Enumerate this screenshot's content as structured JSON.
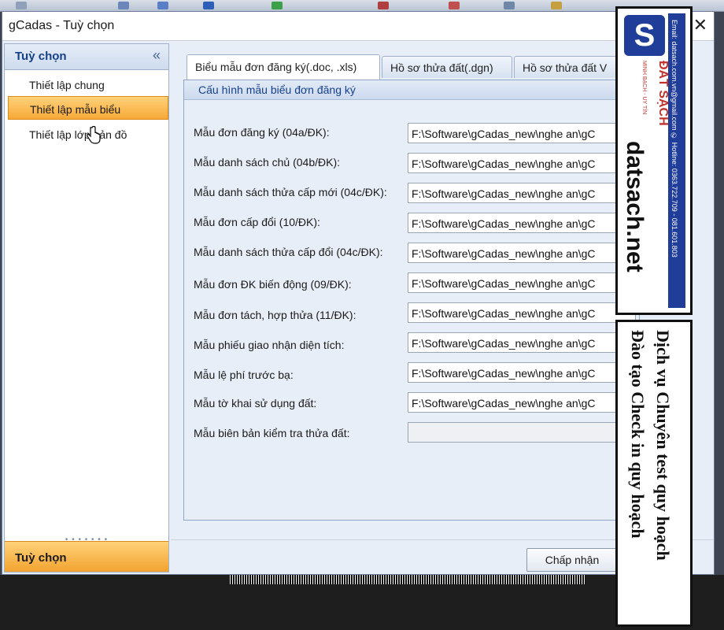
{
  "window": {
    "title": "gCadas - Tuỳ chọn",
    "close_glyph": "✕"
  },
  "sidebar": {
    "header": "Tuỳ chọn",
    "collapse_glyph": "«",
    "items": [
      {
        "label": "Thiết lập chung",
        "active": false
      },
      {
        "label": "Thiết lập mẫu biểu",
        "active": true
      },
      {
        "label": "Thiết lập lớp bản đồ",
        "active": false
      }
    ],
    "footer": "Tuỳ chọn"
  },
  "tabs": [
    {
      "label": "Biểu mẫu đơn đăng ký(.doc, .xls)",
      "active": true
    },
    {
      "label": "Hồ sơ thửa đất(.dgn)",
      "active": false
    },
    {
      "label": "Hồ sơ thửa đất V",
      "active": false
    }
  ],
  "group": {
    "title": "Cấu hình mẫu biểu đơn đăng ký",
    "rows": [
      {
        "label": "Mẫu đơn đăng ký (04a/ĐK):",
        "value": "F:\\Software\\gCadas_new\\nghe an\\gC"
      },
      {
        "label": "Mẫu danh sách chủ (04b/ĐK):",
        "value": "F:\\Software\\gCadas_new\\nghe an\\gC"
      },
      {
        "label": "Mẫu danh sách thửa cấp mới (04c/ĐK):",
        "value": "F:\\Software\\gCadas_new\\nghe an\\gC"
      },
      {
        "label": "Mẫu đơn cấp đổi (10/ĐK):",
        "value": "F:\\Software\\gCadas_new\\nghe an\\gC"
      },
      {
        "label": "Mẫu danh sách thửa cấp đổi (04c/ĐK):",
        "value": "F:\\Software\\gCadas_new\\nghe an\\gC"
      },
      {
        "label": "Mẫu đơn ĐK biến động (09/ĐK):",
        "value": "F:\\Software\\gCadas_new\\nghe an\\gC"
      },
      {
        "label": "Mẫu đơn tách, hợp thửa (11/ĐK):",
        "value": "F:\\Software\\gCadas_new\\nghe an\\gC"
      },
      {
        "label": "Mẫu phiếu giao nhận diện tích:",
        "value": "F:\\Software\\gCadas_new\\nghe an\\gC"
      },
      {
        "label": "Mẫu lệ phí trước bạ:",
        "value": "F:\\Software\\gCadas_new\\nghe an\\gC"
      },
      {
        "label": "Mẫu tờ khai sử dụng đất:",
        "value": "F:\\Software\\gCadas_new\\nghe an\\gC"
      },
      {
        "label": "Mẫu biên bản kiểm tra thửa đất:",
        "value": ""
      }
    ]
  },
  "buttons": {
    "accept": "Chấp nhận"
  },
  "ad": {
    "logo_letter": "S",
    "logo_name": "ĐẤT SẠCH",
    "logo_tagline": "MINH BẠCH - UY TÍN",
    "contact": "Email: datsach.com.vn@gmail.com   ✆ Hotline: 0363.722.709 - 081.601.803",
    "site": "datsach.net",
    "line1": "Dịch vụ Chuyên test quy hoạch",
    "line2": "Đào tạo Check in quy hoạch"
  }
}
